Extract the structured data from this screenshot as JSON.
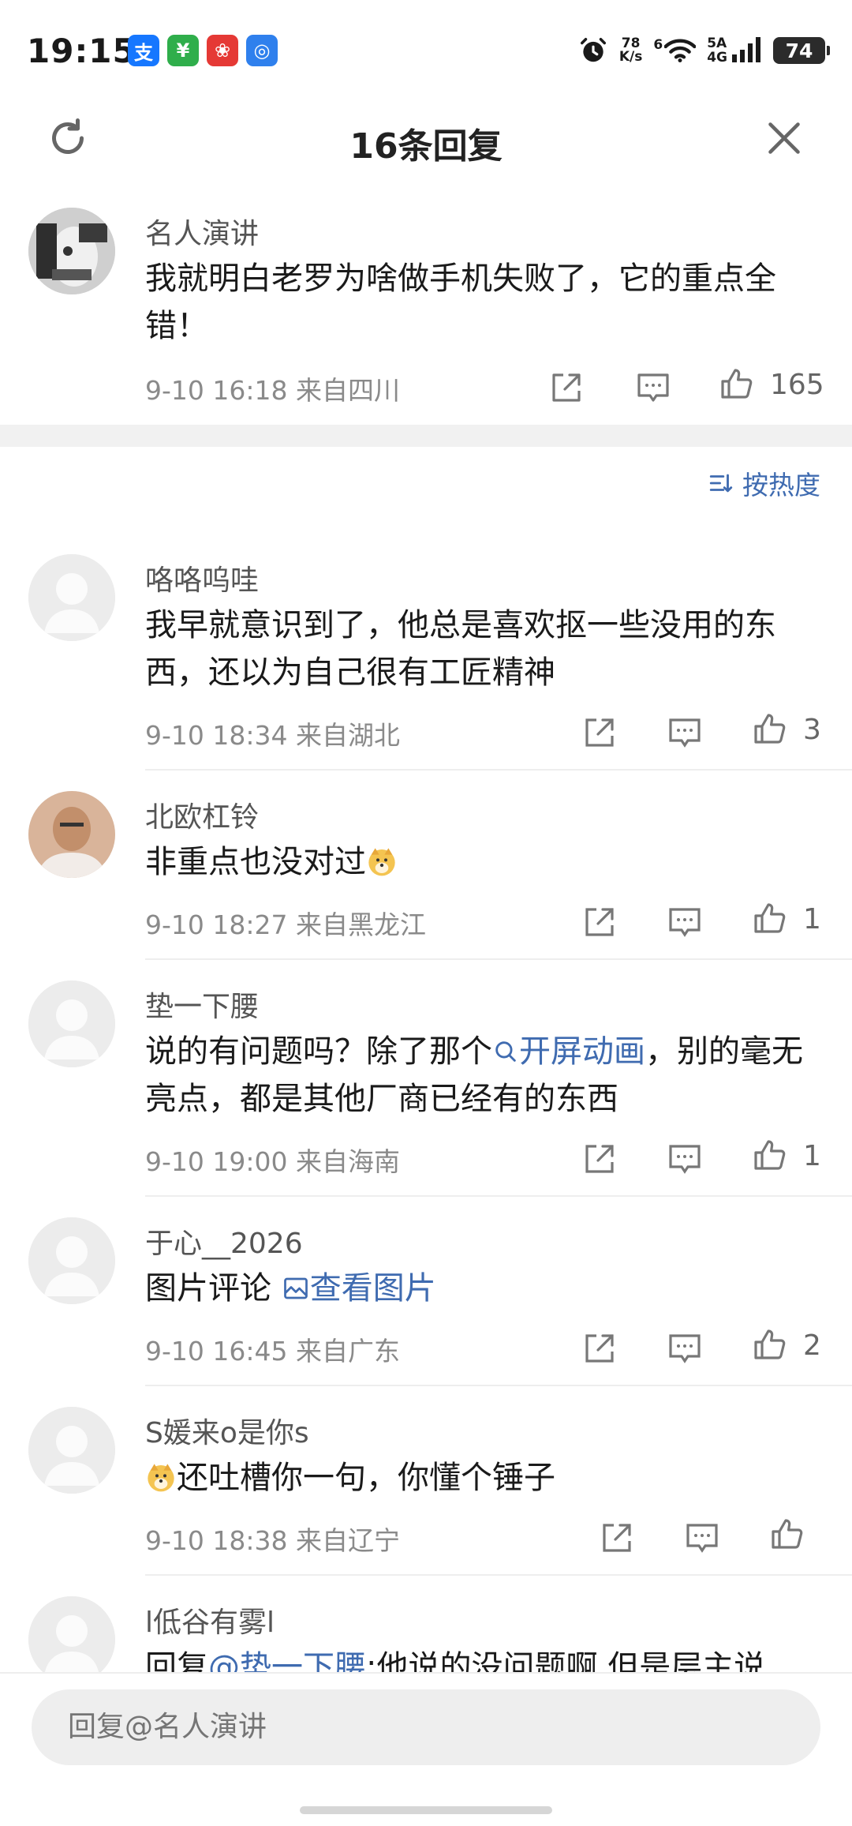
{
  "status_bar": {
    "time": "19:15",
    "net_speed_value": "78",
    "net_speed_unit": "K/s",
    "signal_left": "6",
    "signal_top": "5A",
    "signal_bottom": "4G",
    "battery": "74"
  },
  "header": {
    "title": "16条回复"
  },
  "main_post": {
    "username": "名人演讲",
    "text": "我就明白老罗为啥做手机失败了，它的重点全错！",
    "meta": "9-10 16:18 来自四川",
    "likes": "165"
  },
  "sort": {
    "label": "按热度"
  },
  "replies": [
    {
      "username": "咯咯呜哇",
      "text": "我早就意识到了，他总是喜欢抠一些没用的东西，还以为自己很有工匠精神",
      "meta": "9-10 18:34 来自湖北",
      "likes": "3"
    },
    {
      "username": "北欧杠铃",
      "text": "非重点也没对过",
      "meta": "9-10 18:27 来自黑龙江",
      "likes": "1"
    },
    {
      "username": "垫一下腰",
      "text_before": "说的有问题吗？除了那个",
      "link": "开屏动画",
      "text_after": "，别的毫无亮点，都是其他厂商已经有的东西",
      "meta": "9-10 19:00 来自海南",
      "likes": "1"
    },
    {
      "username": "于心__2026",
      "text": "图片评论",
      "link": "查看图片",
      "meta": "9-10 16:45 来自广东",
      "likes": "2"
    },
    {
      "username": "S媛来o是你s",
      "text": "还吐槽你一句，你懂个锤子",
      "meta": "9-10 18:38 来自辽宁",
      "likes": ""
    },
    {
      "username": "l低谷有雾l",
      "text_before": "回复",
      "mention": "@垫一下腰",
      "text_after": ":他说的没问题啊 但是层主说"
    }
  ],
  "reply_bar": {
    "placeholder": "回复@名人演讲"
  },
  "colors": {
    "link": "#3f6bb0",
    "meta": "#8a8a8a",
    "divider": "#eeeeee"
  }
}
